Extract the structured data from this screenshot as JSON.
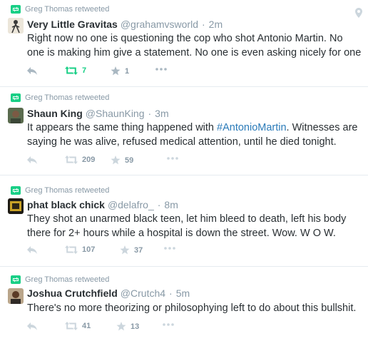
{
  "tweets": [
    {
      "retweeted_by": "Greg Thomas retweeted",
      "name": "Very Little Gravitas",
      "handle": "@grahamvsworld",
      "dot": "·",
      "time": "2m",
      "text": "Right now no one is questioning the cop who shot Antonio Martin. No one is making him give a statement. No one is even asking nicely for one",
      "retweets": "7",
      "favorites": "1",
      "retweeted_by_viewer": true
    },
    {
      "retweeted_by": "Greg Thomas retweeted",
      "name": "Shaun King",
      "handle": "@ShaunKing",
      "dot": "·",
      "time": "3m",
      "text_before": "It appears the same thing happened with ",
      "hashtag": "#AntonioMartin",
      "text_after": ". Witnesses are saying he was alive, refused medical attention, until he died tonight.",
      "retweets": "209",
      "favorites": "59",
      "retweeted_by_viewer": false
    },
    {
      "retweeted_by": "Greg Thomas retweeted",
      "name": "phat black chick",
      "handle": "@delafro_",
      "dot": "·",
      "time": "8m",
      "text": "They shot an unarmed black teen, let him bleed to death, left his body there for 2+ hours while a hospital is down the street. Wow. W O W.",
      "retweets": "107",
      "favorites": "37",
      "retweeted_by_viewer": false
    },
    {
      "retweeted_by": "Greg Thomas retweeted",
      "name": "Joshua Crutchfield",
      "handle": "@Crutch4",
      "dot": "·",
      "time": "5m",
      "text": "There's no more theorizing or philosophying left to do about this bullshit.",
      "retweets": "41",
      "favorites": "13",
      "retweeted_by_viewer": false
    }
  ],
  "colors": {
    "accent_retweet": "#19cf86",
    "muted": "#8899a6",
    "hashtag": "#2b7bb9",
    "text": "#292f33",
    "divider": "#e6ecf0"
  },
  "icons": [
    "retweet-icon",
    "reply-icon",
    "favorite-icon",
    "more-icon",
    "location-pin-icon"
  ]
}
